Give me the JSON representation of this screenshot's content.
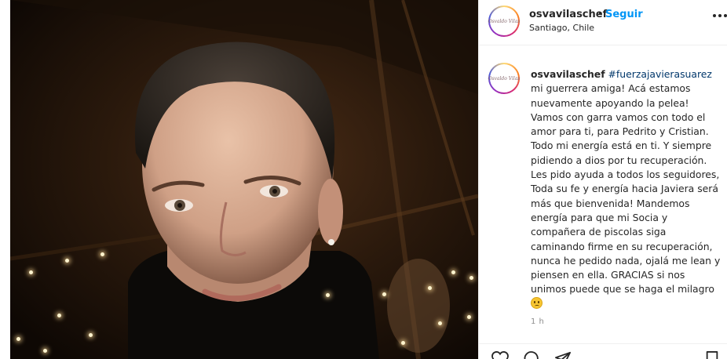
{
  "header": {
    "username": "osvavilaschef",
    "separator": "•",
    "follow_label": "Seguir",
    "location": "Santiago, Chile",
    "avatar_text": "Osvaldo Vilas"
  },
  "caption": {
    "username": "osvavilaschef",
    "hashtag": "#fuerzajavierasuarez",
    "text": " mi guerrera amiga! Acá estamos nuevamente apoyando la pelea! Vamos con garra vamos con todo el amor para ti, para Pedrito y Cristian. Todo mi energía está en ti. Y siempre pidiendo a dios por tu recuperación. Les pido ayuda a todos los seguidores, Toda su fe y energía hacia Javiera será más que bienvenida! Mandemos energía para que mi Socia y compañera de piscolas siga caminando firme en su recuperación, nunca he pedido nada, ojalá me lean y piensen en ella. GRACIAS si nos unimos puede que se haga el milagro ",
    "emoji": "smiling-face-emoji",
    "time": "1 h"
  },
  "icons": {
    "more": "more-options-icon",
    "like": "heart-icon",
    "comment": "comment-icon",
    "share": "share-icon",
    "save": "bookmark-icon"
  },
  "colors": {
    "follow": "#0095f6",
    "text": "#262626",
    "muted": "#8e8e8e",
    "hashtag": "#00376b"
  }
}
